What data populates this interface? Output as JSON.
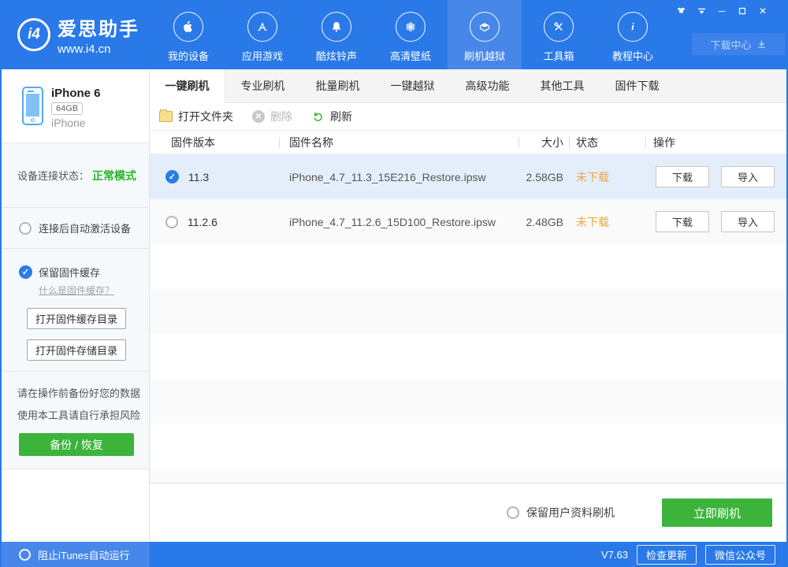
{
  "window": {
    "logo": {
      "badge": "i4",
      "title": "爱思助手",
      "url": "www.i4.cn"
    },
    "controls": {
      "icons": [
        "skin-shirt-icon",
        "boss-key-icon",
        "minimize-icon",
        "maximize-icon",
        "close-icon"
      ],
      "minimize": "─",
      "maximize": "❐",
      "close": "✕"
    },
    "download_center": {
      "label": "下载中心",
      "icon": "download-icon"
    },
    "nav": {
      "active_index": 4,
      "items": [
        {
          "label": "我的设备",
          "icon": "apple-icon"
        },
        {
          "label": "应用游戏",
          "icon": "appstore-icon"
        },
        {
          "label": "酷炫铃声",
          "icon": "bell-icon"
        },
        {
          "label": "高清壁纸",
          "icon": "wallpaper-flower-icon"
        },
        {
          "label": "刷机越狱",
          "icon": "jailbreak-box-icon"
        },
        {
          "label": "工具箱",
          "icon": "toolbox-icon"
        },
        {
          "label": "教程中心",
          "icon": "info-icon"
        }
      ]
    }
  },
  "sidebar": {
    "device": {
      "name": "iPhone 6",
      "capacity": "64GB",
      "model": "iPhone",
      "icon": "iphone-icon"
    },
    "status": {
      "label": "设备连接状态：",
      "value": "正常模式"
    },
    "activate_radio": {
      "label": "连接后自动激活设备",
      "checked": false
    },
    "cache": {
      "checkbox_label": "保留固件缓存",
      "checkbox_checked": true,
      "check_glyph": "✓",
      "link": "什么是固件缓存？",
      "open_cache_dir": "打开固件缓存目录",
      "open_storage_dir": "打开固件存储目录"
    },
    "warning_line1": "请在操作前备份好您的数据",
    "warning_line2": "使用本工具请自行承担风险",
    "backup_button": "备份 / 恢复",
    "itunes_radio": {
      "label": "阻止iTunes自动运行",
      "checked": false
    }
  },
  "main": {
    "tabs": [
      "一键刷机",
      "专业刷机",
      "批量刷机",
      "一键越狱",
      "高级功能",
      "其他工具",
      "固件下载"
    ],
    "active_tab_index": 0,
    "toolbar": {
      "open_folder": {
        "label": "打开文件夹",
        "icon": "folder-icon"
      },
      "delete": {
        "label": "删除",
        "icon": "delete-circle-icon",
        "disabled": true,
        "glyph": "✕"
      },
      "refresh": {
        "label": "刷新",
        "icon": "refresh-icon"
      }
    },
    "table": {
      "headers": [
        "固件版本",
        "固件名称",
        "大小",
        "状态",
        "操作"
      ],
      "rows": [
        {
          "selected": true,
          "check_glyph": "✓",
          "version": "11.3",
          "name": "iPhone_4.7_11.3_15E216_Restore.ipsw",
          "size": "2.58GB",
          "status": "未下载",
          "actions": [
            "下载",
            "导入"
          ]
        },
        {
          "selected": false,
          "version": "11.2.6",
          "name": "iPhone_4.7_11.2.6_15D100_Restore.ipsw",
          "size": "2.48GB",
          "status": "未下载",
          "actions": [
            "下载",
            "导入"
          ]
        }
      ]
    },
    "flash_bar": {
      "radio_label": "保留用户资料刷机",
      "radio_checked": false,
      "flash_button": "立即刷机"
    }
  },
  "footer": {
    "version": "V7.63",
    "check_update": "检查更新",
    "wechat": "微信公众号"
  },
  "colors": {
    "header_blue": "#2979e8",
    "active_nav_blue": "#4787e9",
    "accent_blue": "#2b7ce5",
    "green": "#3cb43c",
    "status_green": "#27b527",
    "status_orange": "#f0a63c",
    "selected_row_blue": "#e4eefb",
    "stripe_gray": "#fafafa"
  }
}
